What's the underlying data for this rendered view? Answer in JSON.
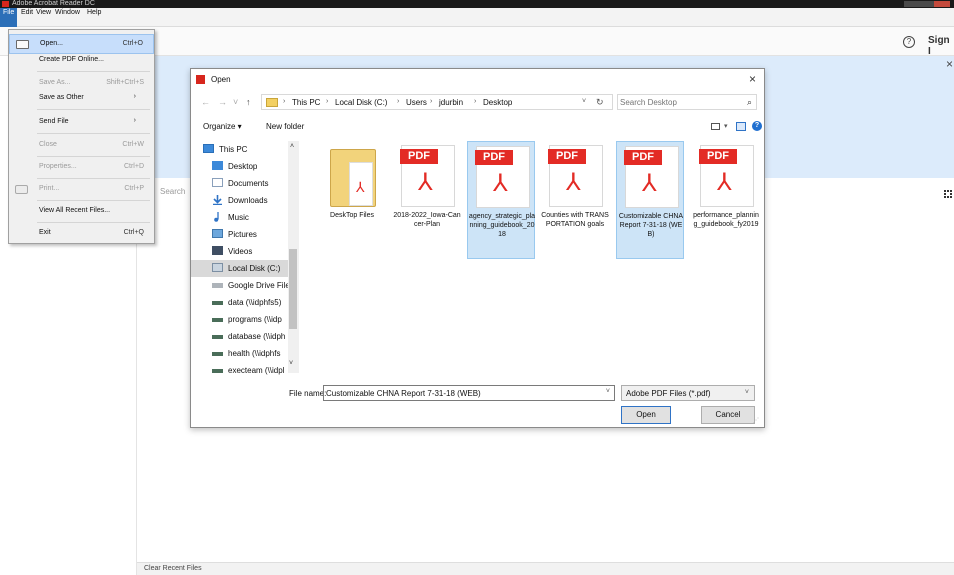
{
  "app": {
    "title": "Adobe Acrobat Reader DC",
    "menu": [
      "File",
      "Edit",
      "View",
      "Window",
      "Help"
    ],
    "sign_in": "Sign I",
    "search_partial": "Search",
    "clear_recent": "Clear Recent Files"
  },
  "file_menu": {
    "items": [
      {
        "label": "Open...",
        "shortcut": "Ctrl+O",
        "icon": "folder-open-icon",
        "highlighted": true,
        "disabled": false
      },
      {
        "label": "Create PDF Online...",
        "shortcut": "",
        "disabled": false
      },
      {
        "label": "Save As...",
        "shortcut": "Shift+Ctrl+S",
        "disabled": true
      },
      {
        "label": "Save as Other",
        "submenu": true,
        "disabled": false
      },
      {
        "label": "Send File",
        "submenu": true,
        "disabled": false
      },
      {
        "label": "Close",
        "shortcut": "Ctrl+W",
        "disabled": true
      },
      {
        "label": "Properties...",
        "shortcut": "Ctrl+D",
        "disabled": true
      },
      {
        "label": "Print...",
        "shortcut": "Ctrl+P",
        "icon": "print-icon",
        "disabled": true
      },
      {
        "label": "View All Recent Files...",
        "shortcut": "",
        "disabled": false
      },
      {
        "label": "Exit",
        "shortcut": "Ctrl+Q",
        "disabled": false
      }
    ]
  },
  "dialog": {
    "title": "Open",
    "breadcrumb": [
      "This PC",
      "Local Disk (C:)",
      "Users",
      "jdurbin",
      "Desktop"
    ],
    "search_placeholder": "Search Desktop",
    "organize": "Organize ▾",
    "new_folder": "New folder",
    "nav": [
      {
        "label": "This PC",
        "icon": "this-pc-icon"
      },
      {
        "label": "Desktop",
        "icon": "desktop-icon"
      },
      {
        "label": "Documents",
        "icon": "documents-icon"
      },
      {
        "label": "Downloads",
        "icon": "downloads-icon"
      },
      {
        "label": "Music",
        "icon": "music-icon"
      },
      {
        "label": "Pictures",
        "icon": "pictures-icon"
      },
      {
        "label": "Videos",
        "icon": "videos-icon"
      },
      {
        "label": "Local Disk (C:)",
        "icon": "local-disk-icon",
        "selected": true
      },
      {
        "label": "Google Drive File",
        "icon": "drive-icon"
      },
      {
        "label": "data (\\\\idphfs5)",
        "icon": "network-drive-icon"
      },
      {
        "label": "programs (\\\\idp",
        "icon": "network-drive-icon"
      },
      {
        "label": "database (\\\\idph",
        "icon": "network-drive-icon"
      },
      {
        "label": "health (\\\\idphfs",
        "icon": "network-drive-icon"
      },
      {
        "label": "execteam (\\\\idpl",
        "icon": "network-drive-disconnected-icon"
      }
    ],
    "files": [
      {
        "name": "DeskTop Files",
        "type": "folder"
      },
      {
        "name": "2018-2022_Iowa-Cancer-Plan",
        "type": "pdf"
      },
      {
        "name": "agency_strategic_planning_guidebook_2018",
        "type": "pdf",
        "selected": true
      },
      {
        "name": "Counties with TRANSPORTATION goals",
        "type": "pdf"
      },
      {
        "name": "Customizable CHNA Report 7-31-18 (WEB)",
        "type": "pdf",
        "selected": true
      },
      {
        "name": "performance_planning_guidebook_fy2019",
        "type": "pdf"
      }
    ],
    "file_name_label": "File name:",
    "file_name_value": "Customizable CHNA Report 7-31-18 (WEB)",
    "file_type": "Adobe PDF Files (*.pdf)",
    "open_button": "Open",
    "cancel_button": "Cancel"
  }
}
